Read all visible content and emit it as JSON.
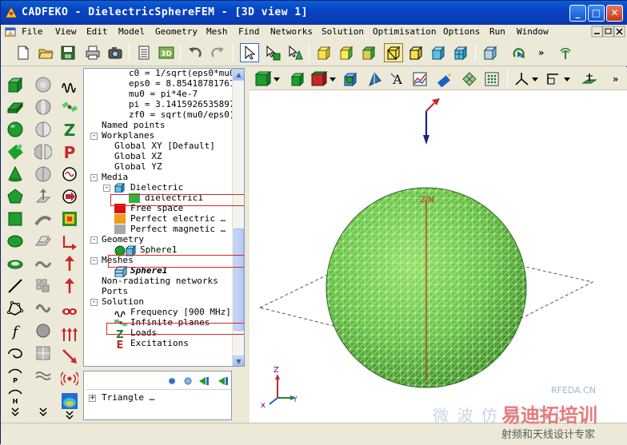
{
  "window": {
    "title": "CADFEKO - DielectricSphereFEM - [3D view 1]",
    "controls": {
      "minimize": "_",
      "maximize": "□",
      "close": "✕"
    }
  },
  "menu": {
    "items": [
      "File",
      "View",
      "Edit",
      "Model",
      "Geometry",
      "Mesh",
      "Find",
      "Networks",
      "Solution",
      "Optimisation",
      "Options",
      "Run",
      "Window"
    ]
  },
  "toolbar_overflow": "»",
  "tree": {
    "rows": [
      {
        "text": "c0 = 1/sqrt(eps0*mu0)",
        "indent": 3
      },
      {
        "text": "eps0 = 8.85418781761…",
        "indent": 3
      },
      {
        "text": "mu0 = pi*4e-7",
        "indent": 3
      },
      {
        "text": "pi = 3.1415926535897…",
        "indent": 3
      },
      {
        "text": "zf0 = sqrt(mu0/eps0)",
        "indent": 3
      },
      {
        "text": "Named points",
        "indent": 1
      },
      {
        "text": "Workplanes",
        "indent": 1,
        "toggle": "-"
      },
      {
        "text": "Global XY [Default]",
        "indent": 2
      },
      {
        "text": "Global XZ",
        "indent": 2
      },
      {
        "text": "Global YZ",
        "indent": 2
      },
      {
        "text": "Media",
        "indent": 1,
        "toggle": "-"
      },
      {
        "text": "Dielectric",
        "indent": 2,
        "toggle": "-"
      },
      {
        "text": "dielectric1",
        "indent": 3
      },
      {
        "text": "Free space",
        "indent": 2
      },
      {
        "text": "Perfect electric …",
        "indent": 2
      },
      {
        "text": "Perfect magnetic …",
        "indent": 2
      },
      {
        "text": "Geometry",
        "indent": 1,
        "toggle": "-"
      },
      {
        "text": "Sphere1",
        "indent": 2
      },
      {
        "text": "Meshes",
        "indent": 1,
        "toggle": "-"
      },
      {
        "text": "Sphere1",
        "indent": 2
      },
      {
        "text": "Non-radiating networks",
        "indent": 1
      },
      {
        "text": "Ports",
        "indent": 1
      },
      {
        "text": "Solution",
        "indent": 1,
        "toggle": "-"
      },
      {
        "text": "Frequency [900 MHz]",
        "indent": 2
      },
      {
        "text": "Infinite planes",
        "indent": 2
      },
      {
        "text": "Loads",
        "indent": 2
      },
      {
        "text": "Excitations",
        "indent": 2
      }
    ]
  },
  "details": {
    "rows": [
      {
        "text": "Triangle …"
      }
    ]
  },
  "view3d": {
    "axis_label_top": "Z/N",
    "triad_labels": {
      "x": "x",
      "y": "Y",
      "z": "Z"
    }
  },
  "colors": {
    "dielectric": "#31B33B",
    "free_space": "#E01010",
    "perfect_electric": "#F39A1A",
    "perfect_magnetic": "#A8A8A8",
    "sphere_fill": "#6DCB45",
    "highlight": "#D7262C"
  },
  "watermarks": {
    "site": "RFEDA.CN",
    "text1": "微 波 仿 真 论 坛",
    "text2": "易迪拓培训",
    "text3": "射频和天线设计专家"
  }
}
